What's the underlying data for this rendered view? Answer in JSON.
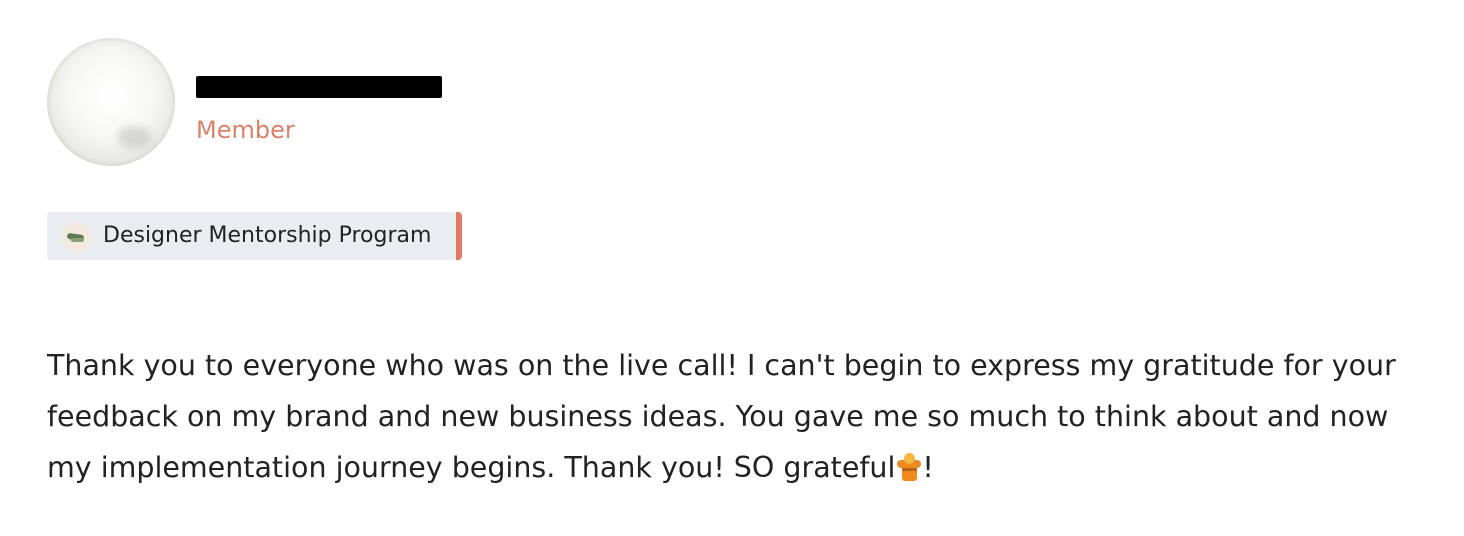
{
  "post": {
    "author": {
      "name": "",
      "role": "Member"
    },
    "tag": {
      "label": "Designer Mentorship Program",
      "icon": "sneaker-icon"
    },
    "body": {
      "text": "Thank you to everyone who was on the live call! I can't begin to express my gratitude for your feedback on my brand and new business ideas. You gave me so much to think about and now my implementation journey begins. Thank you! SO grateful",
      "emoji": "person-bowing-emoji",
      "suffix": "!"
    }
  },
  "colors": {
    "role_text": "#d9826a",
    "tag_background": "#ebecef",
    "tag_accent": "#e07a63",
    "body_text": "#222222"
  }
}
